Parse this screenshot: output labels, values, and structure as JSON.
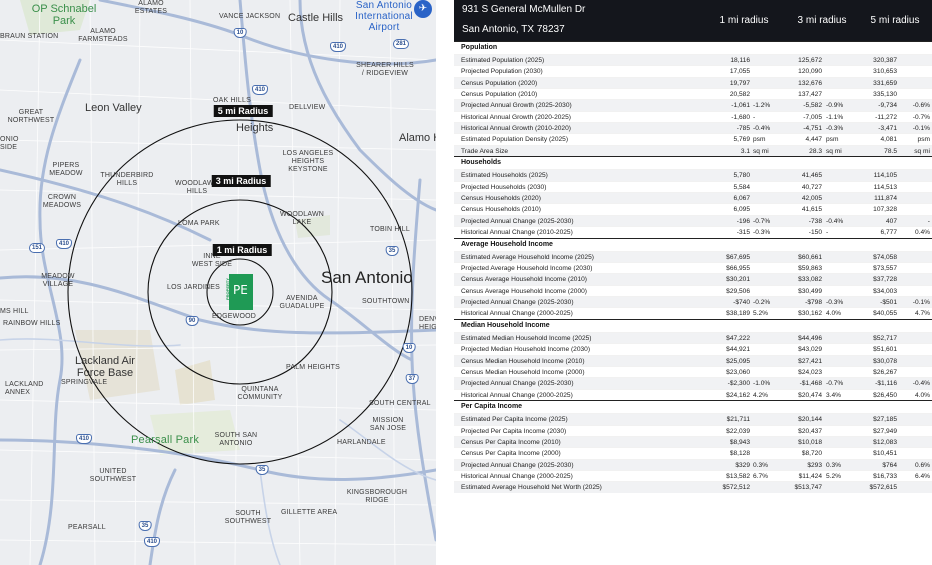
{
  "map": {
    "radius_labels": [
      "1 mi Radius",
      "3 mi Radius",
      "5 mi Radius"
    ],
    "city": "San Antonio",
    "places": {
      "op_schnabel": "OP Schnabel\nPark",
      "alamo_estates": "ALAMO\nESTATES",
      "vance_jackson": "VANCE JACKSON",
      "castle_hills": "Castle Hills",
      "airport": "San Antonio\nInternational\nAirport",
      "braun_station": "BRAUN STATION",
      "alamo_farmsteads": "ALAMO\nFARMSTEADS",
      "shearer_hills": "SHEARER HILLS\n/ RIDGEVIEW",
      "leon_valley": "Leon Valley",
      "oak_hills": "OAK HILLS",
      "dellview": "DELLVIEW",
      "great_northwest": "GREAT\nNORTHWEST",
      "antonio": "ONIO\nSIDE",
      "jefferson_heights": "Heights",
      "alamo_heights": "Alamo H",
      "los_angeles_heights": "LOS ANGELES\nHEIGHTS\nKEYSTONE",
      "pipers_meadow": "PIPERS\nMEADOW",
      "thunderbird_hills": "THUNDERBIRD\nHILLS",
      "woodlawn_hills": "WOODLAWN\nHILLS",
      "crown_meadows": "CROWN\nMEADOWS",
      "woodlawn_lake": "WOODLAWN\nLAKE",
      "loma_park": "LOMA PARK",
      "tobin_hill": "TOBIN HILL",
      "inner_west_side": "INNE\nWEST SIDE",
      "meadow_village": "MEADOW\nVILLAGE",
      "los_jardines": "LOS JARDINES",
      "avenida_guadalupe": "AVENIDA\nGUADALUPE",
      "southtown": "SOUTHTOWN",
      "ms_hill": "MS HILL",
      "rainbow_hills": "RAINBOW HILLS",
      "edgewood": "EDGEWOOD",
      "denver_heights": "DENV\nHEIG",
      "lackland": "Lackland Air\nForce Base",
      "palm_heights": "PALM HEIGHTS",
      "lackland_annex": "LACKLAND\nANNEX",
      "springvale": "SPRINGVALE",
      "quintana": "QUINTANA\nCOMMUNITY",
      "south_central": "SOUTH CENTRAL",
      "mission_san_jose": "MISSION\nSAN JOSE",
      "pearsall_park": "Pearsall Park",
      "south_san_antonio": "SOUTH SAN\nANTONIO",
      "harlandale": "HARLANDALE",
      "united_southwest": "UNITED\nSOUTHWEST",
      "kingsborough": "KINGSBOROUGH\nRIDGE",
      "pearsall": "PEARSALL",
      "south_southwest": "SOUTH\nSOUTHWEST",
      "gillette_area": "GILLETTE AREA"
    },
    "shields": [
      "10",
      "410",
      "281",
      "410",
      "151",
      "410",
      "35",
      "90",
      "10",
      "37",
      "410",
      "35",
      "35",
      "410"
    ],
    "marker_letter": "PE",
    "marker_side": "PROPERTY"
  },
  "report": {
    "address_line1": "931 S General McMullen Dr",
    "address_line2": "San Antonio, TX 78237",
    "columns": [
      "1 mi radius",
      "3 mi radius",
      "5 mi radius"
    ],
    "sections": [
      {
        "title": "Population",
        "rows": [
          {
            "label": "Estimated Population (2025)",
            "v": [
              "18,116",
              "",
              "125,672",
              "",
              "320,387",
              ""
            ]
          },
          {
            "label": "Projected Population (2030)",
            "v": [
              "17,055",
              "",
              "120,090",
              "",
              "310,653",
              ""
            ]
          },
          {
            "label": "Census Population (2020)",
            "v": [
              "19,797",
              "",
              "132,676",
              "",
              "331,659",
              ""
            ]
          },
          {
            "label": "Census Population (2010)",
            "v": [
              "20,582",
              "",
              "137,427",
              "",
              "335,130",
              ""
            ]
          },
          {
            "label": "Projected Annual Growth (2025-2030)",
            "v": [
              "-1,061",
              "-1.2%",
              "-5,582",
              "-0.9%",
              "-9,734",
              "-0.6%"
            ]
          },
          {
            "label": "Historical Annual Growth (2020-2025)",
            "v": [
              "-1,680",
              "-",
              "-7,005",
              "-1.1%",
              "-11,272",
              "-0.7%"
            ]
          },
          {
            "label": "Historical Annual Growth (2010-2020)",
            "v": [
              "-785",
              "-0.4%",
              "-4,751",
              "-0.3%",
              "-3,471",
              "-0.1%"
            ]
          },
          {
            "label": "Estimated Population Density (2025)",
            "v": [
              "5,769",
              "psm",
              "4,447",
              "psm",
              "4,081",
              "psm"
            ]
          },
          {
            "label": "Trade Area Size",
            "v": [
              "3.1",
              "sq mi",
              "28.3",
              "sq mi",
              "78.5",
              "sq mi"
            ]
          }
        ]
      },
      {
        "title": "Households",
        "rows": [
          {
            "label": "Estimated Households (2025)",
            "v": [
              "5,780",
              "",
              "41,465",
              "",
              "114,105",
              ""
            ]
          },
          {
            "label": "Projected Households (2030)",
            "v": [
              "5,584",
              "",
              "40,727",
              "",
              "114,513",
              ""
            ]
          },
          {
            "label": "Census Households (2020)",
            "v": [
              "6,067",
              "",
              "42,005",
              "",
              "111,874",
              ""
            ]
          },
          {
            "label": "Census Households (2010)",
            "v": [
              "6,095",
              "",
              "41,615",
              "",
              "107,328",
              ""
            ]
          },
          {
            "label": "Projected Annual Change (2025-2030)",
            "v": [
              "-196",
              "-0.7%",
              "-738",
              "-0.4%",
              "407",
              "-"
            ]
          },
          {
            "label": "Historical Annual Change (2010-2025)",
            "v": [
              "-315",
              "-0.3%",
              "-150",
              "-",
              "6,777",
              "0.4%"
            ]
          }
        ]
      },
      {
        "title": "Average Household Income",
        "rows": [
          {
            "label": "Estimated Average Household Income (2025)",
            "v": [
              "$67,695",
              "",
              "$60,661",
              "",
              "$74,058",
              ""
            ]
          },
          {
            "label": "Projected Average Household Income (2030)",
            "v": [
              "$66,955",
              "",
              "$59,863",
              "",
              "$73,557",
              ""
            ]
          },
          {
            "label": "Census Average Household Income (2010)",
            "v": [
              "$30,201",
              "",
              "$33,082",
              "",
              "$37,728",
              ""
            ]
          },
          {
            "label": "Census Average Household Income (2000)",
            "v": [
              "$29,506",
              "",
              "$30,499",
              "",
              "$34,003",
              ""
            ]
          },
          {
            "label": "Projected Annual Change (2025-2030)",
            "v": [
              "-$740",
              "-0.2%",
              "-$798",
              "-0.3%",
              "-$501",
              "-0.1%"
            ]
          },
          {
            "label": "Historical Annual Change (2000-2025)",
            "v": [
              "$38,189",
              "5.2%",
              "$30,162",
              "4.0%",
              "$40,055",
              "4.7%"
            ]
          }
        ]
      },
      {
        "title": "Median Household Income",
        "rows": [
          {
            "label": "Estimated Median Household Income (2025)",
            "v": [
              "$47,222",
              "",
              "$44,496",
              "",
              "$52,717",
              ""
            ]
          },
          {
            "label": "Projected Median Household Income (2030)",
            "v": [
              "$44,921",
              "",
              "$43,029",
              "",
              "$51,601",
              ""
            ]
          },
          {
            "label": "Census Median Household Income (2010)",
            "v": [
              "$25,095",
              "",
              "$27,421",
              "",
              "$30,078",
              ""
            ]
          },
          {
            "label": "Census Median Household Income (2000)",
            "v": [
              "$23,060",
              "",
              "$24,023",
              "",
              "$26,267",
              ""
            ]
          },
          {
            "label": "Projected Annual Change (2025-2030)",
            "v": [
              "-$2,300",
              "-1.0%",
              "-$1,468",
              "-0.7%",
              "-$1,116",
              "-0.4%"
            ]
          },
          {
            "label": "Historical Annual Change (2000-2025)",
            "v": [
              "$24,162",
              "4.2%",
              "$20,474",
              "3.4%",
              "$26,450",
              "4.0%"
            ]
          }
        ]
      },
      {
        "title": "Per Capita Income",
        "rows": [
          {
            "label": "Estimated Per Capita Income (2025)",
            "v": [
              "$21,711",
              "",
              "$20,144",
              "",
              "$27,185",
              ""
            ]
          },
          {
            "label": "Projected Per Capita Income (2030)",
            "v": [
              "$22,039",
              "",
              "$20,437",
              "",
              "$27,949",
              ""
            ]
          },
          {
            "label": "Census Per Capita Income (2010)",
            "v": [
              "$8,943",
              "",
              "$10,018",
              "",
              "$12,083",
              ""
            ]
          },
          {
            "label": "Census Per Capita Income (2000)",
            "v": [
              "$8,128",
              "",
              "$8,720",
              "",
              "$10,451",
              ""
            ]
          },
          {
            "label": "Projected Annual Change (2025-2030)",
            "v": [
              "$329",
              "0.3%",
              "$293",
              "0.3%",
              "$764",
              "0.6%"
            ]
          },
          {
            "label": "Historical Annual Change (2000-2025)",
            "v": [
              "$13,582",
              "6.7%",
              "$11,424",
              "5.2%",
              "$16,733",
              "6.4%"
            ]
          },
          {
            "label": "Estimated Average Household Net Worth (2025)",
            "v": [
              "$572,512",
              "",
              "$513,747",
              "",
              "$572,615",
              ""
            ]
          }
        ]
      }
    ]
  }
}
